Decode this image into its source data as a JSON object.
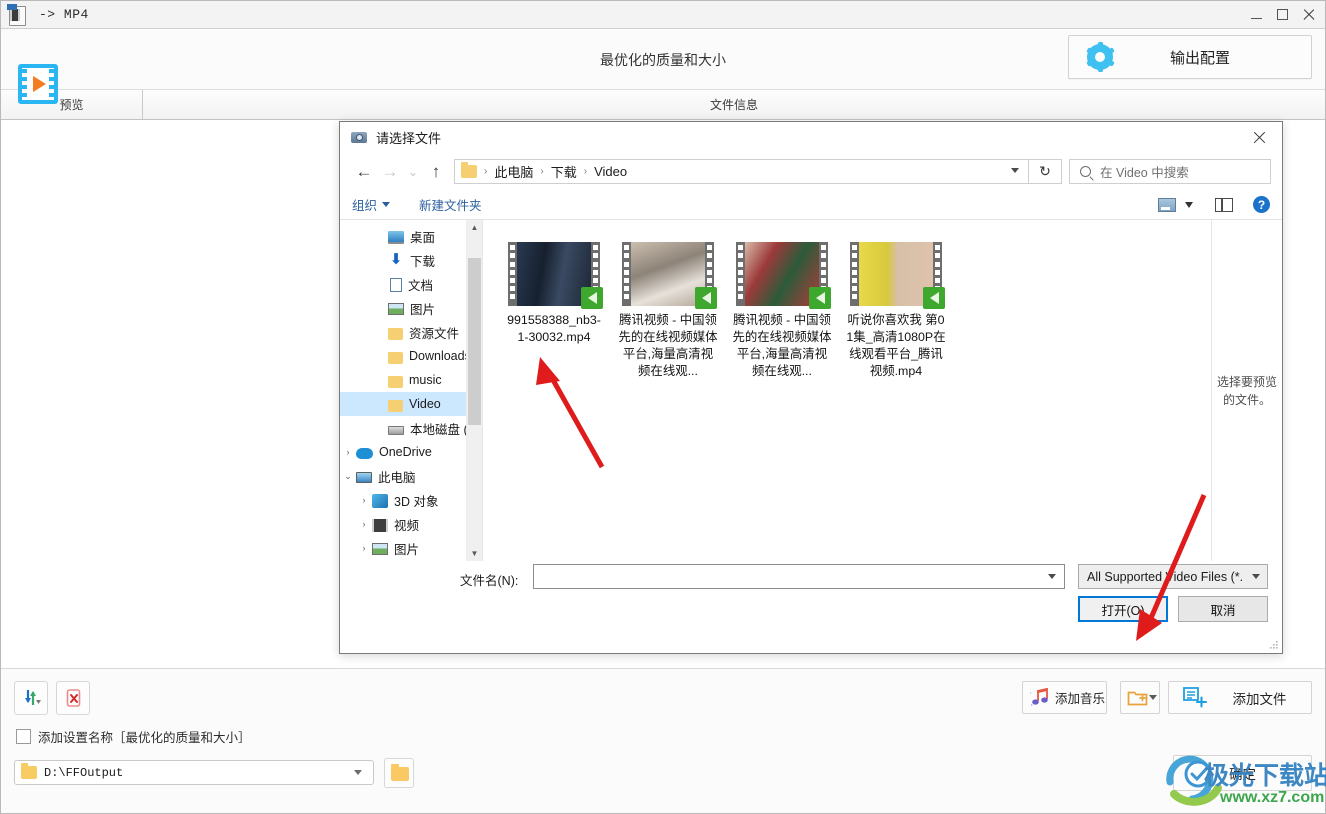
{
  "window": {
    "title": "-> MP4",
    "icon": "video-file-icon",
    "controls": {
      "minimize": "–",
      "maximize": "□",
      "close": "✕"
    }
  },
  "header": {
    "logo": "film-play-icon",
    "title": "最优化的质量和大小",
    "output_config_label": "输出配置",
    "output_config_icon": "gear-icon"
  },
  "tabs": [
    {
      "label": "预览",
      "name": "tab-preview"
    },
    {
      "label": "文件信息",
      "name": "tab-fileinfo"
    }
  ],
  "bottom_panel": {
    "sort_icon": "sort-arrows-icon",
    "clear_icon": "remove-file-icon",
    "checkbox_label": "添加设置名称［最优化的质量和大小］",
    "checkbox_checked": false,
    "output_path": "D:\\FFOutput",
    "browse_icon": "folder-icon",
    "add_music_label": "添加音乐",
    "add_music_icon": "music-note-icon",
    "new_folder_icon": "add-folder-icon",
    "add_file_label": "添加文件",
    "add_file_icon": "add-document-icon",
    "confirm_label": "确定"
  },
  "dialog": {
    "title": "请选择文件",
    "icon": "camera-icon",
    "close_icon": "close-icon",
    "nav": {
      "back_icon": "arrow-left-icon",
      "forward_icon": "arrow-right-icon",
      "recent_icon": "chevron-down-icon",
      "up_icon": "arrow-up-icon",
      "refresh_icon": "refresh-icon",
      "breadcrumb": [
        "此电脑",
        "下载",
        "Video"
      ],
      "breadcrumb_folder_icon": "folder-icon",
      "breadcrumb_caret_icon": "chevron-down-icon"
    },
    "search": {
      "placeholder": "在 Video 中搜索",
      "icon": "search-icon"
    },
    "toolbar": {
      "organize_label": "组织",
      "organize_caret_icon": "chevron-down-icon",
      "new_folder_label": "新建文件夹",
      "view_icon": "view-layout-icon",
      "view_caret_icon": "chevron-down-icon",
      "preview_pane_icon": "preview-pane-icon",
      "help_icon": "help-icon",
      "help_label": "?"
    },
    "tree": [
      {
        "label": "桌面",
        "icon": "desktop-icon",
        "indent": 2,
        "pinned": true,
        "selected": false,
        "twisty": ""
      },
      {
        "label": "下载",
        "icon": "download-icon",
        "indent": 2,
        "pinned": true,
        "selected": false,
        "twisty": ""
      },
      {
        "label": "文档",
        "icon": "document-icon",
        "indent": 2,
        "pinned": true,
        "selected": false,
        "twisty": ""
      },
      {
        "label": "图片",
        "icon": "pictures-icon",
        "indent": 2,
        "pinned": true,
        "selected": false,
        "twisty": ""
      },
      {
        "label": "资源文件",
        "icon": "folder-icon",
        "indent": 2,
        "pinned": true,
        "selected": false,
        "twisty": ""
      },
      {
        "label": "Downloads",
        "icon": "folder-icon",
        "indent": 2,
        "pinned": false,
        "selected": false,
        "twisty": ""
      },
      {
        "label": "music",
        "icon": "folder-icon",
        "indent": 2,
        "pinned": false,
        "selected": false,
        "twisty": ""
      },
      {
        "label": "Video",
        "icon": "folder-icon",
        "indent": 2,
        "pinned": false,
        "selected": true,
        "twisty": ""
      },
      {
        "label": "本地磁盘 (C:)",
        "icon": "drive-icon",
        "indent": 2,
        "pinned": false,
        "selected": false,
        "twisty": ""
      },
      {
        "label": "OneDrive",
        "icon": "onedrive-icon",
        "indent": 0,
        "pinned": false,
        "selected": false,
        "twisty": "›"
      },
      {
        "label": "此电脑",
        "icon": "pc-icon",
        "indent": 0,
        "pinned": false,
        "selected": false,
        "twisty": "⌄"
      },
      {
        "label": "3D 对象",
        "icon": "3d-objects-icon",
        "indent": 1,
        "pinned": false,
        "selected": false,
        "twisty": "›"
      },
      {
        "label": "视频",
        "icon": "video-icon",
        "indent": 1,
        "pinned": false,
        "selected": false,
        "twisty": "›"
      },
      {
        "label": "图片",
        "icon": "pictures-icon",
        "indent": 1,
        "pinned": false,
        "selected": false,
        "twisty": "›"
      }
    ],
    "files": [
      {
        "name": "991558388_nb3-1-30032.mp4",
        "thumb": "dark-blue-scene",
        "badge": "green-player-icon"
      },
      {
        "name": "腾讯视频 - 中国领先的在线视频媒体平台,海量高清视频在线观...",
        "thumb": "bedroom-scene",
        "badge": "green-player-icon"
      },
      {
        "name": "腾讯视频 - 中国领先的在线视频媒体平台,海量高清视频在线观...",
        "thumb": "three-women-scene",
        "badge": "green-player-icon"
      },
      {
        "name": "听说你喜欢我 第01集_高清1080P在线观看平台_腾讯视频.mp4",
        "thumb": "yellow-poster-scene",
        "badge": "green-player-icon"
      }
    ],
    "preview_pane_text": "选择要预览的文件。",
    "footer": {
      "filename_label": "文件名(N):",
      "filename_value": "",
      "filename_caret_icon": "chevron-down-icon",
      "filetype_value": "All Supported Video Files (*.",
      "filetype_caret_icon": "chevron-down-icon",
      "open_label": "打开(O)",
      "cancel_label": "取消"
    }
  },
  "watermark": {
    "text": "极光下载站",
    "url": "www.xz7.com"
  },
  "colors": {
    "accent_blue": "#0078d7",
    "logo_cyan": "#29b6f2",
    "logo_orange": "#f47b20",
    "selection_blue": "#cce8ff",
    "annotation_red": "#e01b1b",
    "badge_green": "#3ea72d"
  }
}
